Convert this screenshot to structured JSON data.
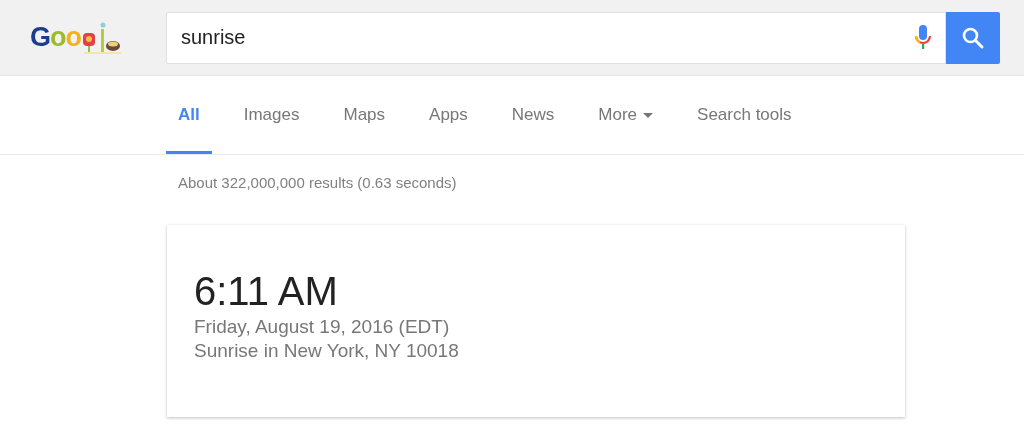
{
  "logo": {
    "text": "Goo"
  },
  "search": {
    "value": "sunrise"
  },
  "tabs": [
    {
      "label": "All",
      "selected": true,
      "dropdown": false
    },
    {
      "label": "Images",
      "selected": false,
      "dropdown": false
    },
    {
      "label": "Maps",
      "selected": false,
      "dropdown": false
    },
    {
      "label": "Apps",
      "selected": false,
      "dropdown": false
    },
    {
      "label": "News",
      "selected": false,
      "dropdown": false
    },
    {
      "label": "More",
      "selected": false,
      "dropdown": true
    },
    {
      "label": "Search tools",
      "selected": false,
      "dropdown": false
    }
  ],
  "result_stats": "About 322,000,000 results (0.63 seconds)",
  "answer_card": {
    "time": "6:11 AM",
    "date": "Friday, August 19, 2016 (EDT)",
    "location": "Sunrise in New York, NY 10018"
  }
}
